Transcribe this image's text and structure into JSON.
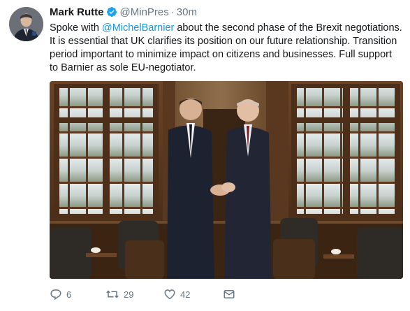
{
  "tweet": {
    "author_name": "Mark Rutte",
    "handle": "@MinPres",
    "separator": "·",
    "time": "30m",
    "text_before_mention": "Spoke with ",
    "mention": "@MichelBarnier",
    "text_after_mention": " about the second phase of the Brexit negotiations. It is essential that UK clarifies its position on our future relationship. Transition period important to minimize impact on citizens and businesses. Full support to Barnier as sole EU-negotiator."
  },
  "actions": {
    "reply_count": "6",
    "retweet_count": "29",
    "like_count": "42"
  },
  "colors": {
    "link": "#1b95e0",
    "verified": "#1da1f2",
    "meta": "#657786"
  },
  "icons": [
    "verified-badge-icon",
    "reply-icon",
    "retweet-icon",
    "like-icon",
    "dm-icon"
  ]
}
